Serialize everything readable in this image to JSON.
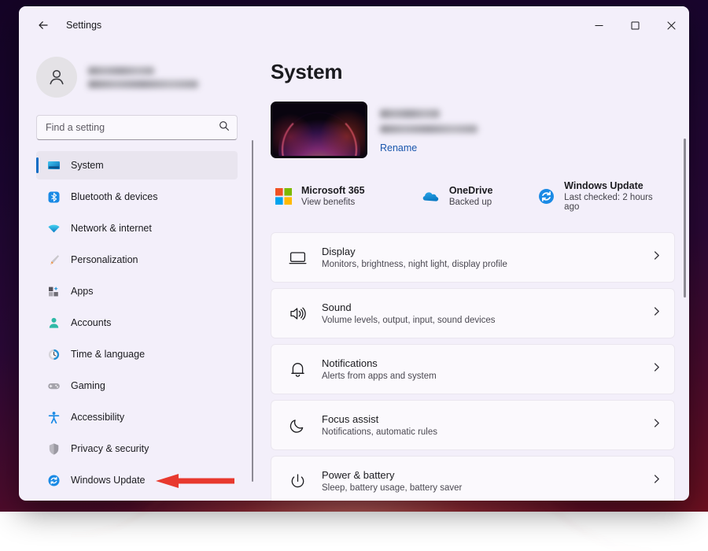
{
  "window": {
    "title": "Settings",
    "back_icon": "back-arrow-icon",
    "controls": {
      "minimize": "minimize-icon",
      "maximize": "maximize-icon",
      "close": "close-icon"
    }
  },
  "account": {
    "avatar_icon": "person-avatar-icon",
    "name_redacted": "",
    "email_redacted": ""
  },
  "search": {
    "placeholder": "Find a setting",
    "value": "",
    "icon": "search-icon"
  },
  "sidebar": {
    "items": [
      {
        "label": "System",
        "icon": "monitor-icon",
        "active": true
      },
      {
        "label": "Bluetooth & devices",
        "icon": "bluetooth-icon",
        "active": false
      },
      {
        "label": "Network & internet",
        "icon": "wifi-icon",
        "active": false
      },
      {
        "label": "Personalization",
        "icon": "paintbrush-icon",
        "active": false
      },
      {
        "label": "Apps",
        "icon": "apps-grid-icon",
        "active": false
      },
      {
        "label": "Accounts",
        "icon": "person-icon",
        "active": false
      },
      {
        "label": "Time & language",
        "icon": "clock-icon",
        "active": false
      },
      {
        "label": "Gaming",
        "icon": "gamepad-icon",
        "active": false
      },
      {
        "label": "Accessibility",
        "icon": "accessibility-person-icon",
        "active": false
      },
      {
        "label": "Privacy & security",
        "icon": "shield-icon",
        "active": false
      },
      {
        "label": "Windows Update",
        "icon": "sync-refresh-icon",
        "active": false
      }
    ]
  },
  "main": {
    "page_title": "System",
    "device": {
      "thumbnail_icon": "windows-bloom-wallpaper-thumbnail",
      "name_redacted": "",
      "model_redacted": "",
      "rename_label": "Rename"
    },
    "status_tiles": [
      {
        "title": "Microsoft 365",
        "subtitle": "View benefits",
        "icon": "microsoft-logo-icon"
      },
      {
        "title": "OneDrive",
        "subtitle": "Backed up",
        "icon": "onedrive-cloud-icon"
      },
      {
        "title": "Windows Update",
        "subtitle": "Last checked: 2 hours ago",
        "icon": "sync-refresh-icon"
      }
    ],
    "rows": [
      {
        "title": "Display",
        "subtitle": "Monitors, brightness, night light, display profile",
        "icon": "monitor-outline-icon"
      },
      {
        "title": "Sound",
        "subtitle": "Volume levels, output, input, sound devices",
        "icon": "speaker-icon"
      },
      {
        "title": "Notifications",
        "subtitle": "Alerts from apps and system",
        "icon": "bell-icon"
      },
      {
        "title": "Focus assist",
        "subtitle": "Notifications, automatic rules",
        "icon": "moon-icon"
      },
      {
        "title": "Power & battery",
        "subtitle": "Sleep, battery usage, battery saver",
        "icon": "power-icon"
      }
    ]
  },
  "annotation": {
    "arrow_icon": "red-left-arrow-annotation",
    "color": "#e8392e",
    "points_to": "Windows Update"
  },
  "colors": {
    "accent": "#0d6cc4",
    "link": "#1a57ad",
    "window_bg": "#f3effa",
    "card_bg": "#fbf9fd",
    "annotation_red": "#e8392e"
  }
}
